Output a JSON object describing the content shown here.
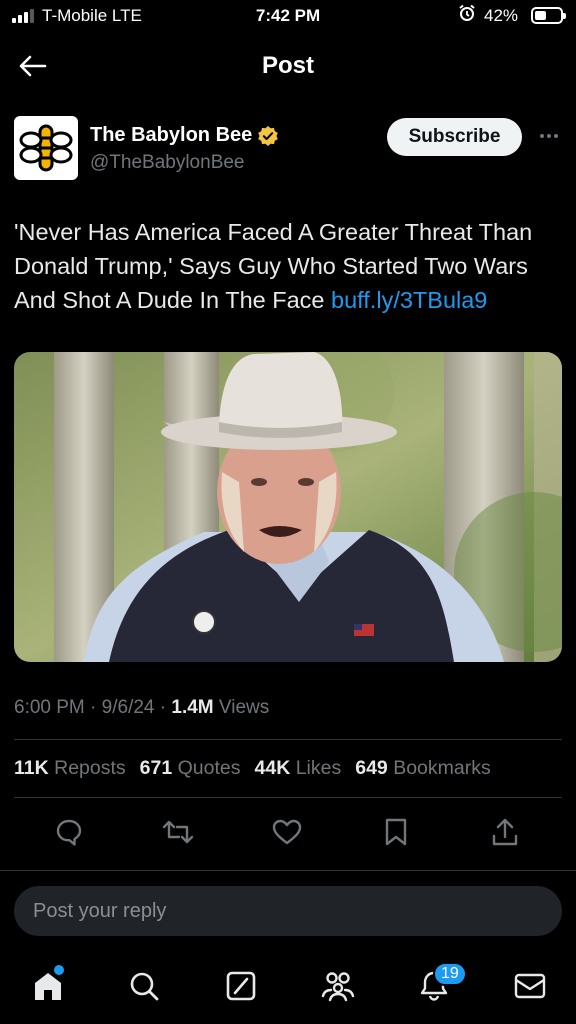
{
  "status_bar": {
    "carrier": "T-Mobile  LTE",
    "time": "7:42 PM",
    "battery": "42%",
    "battery_level": 0.42
  },
  "header": {
    "title": "Post",
    "back_icon": "arrow-left-icon"
  },
  "author": {
    "name": "The Babylon Bee",
    "handle": "@TheBabylonBee",
    "verified": true,
    "verified_color": "#f4c443",
    "subscribe_label": "Subscribe"
  },
  "post": {
    "text": "'Never Has America Faced A Greater Threat Than Donald Trump,' Says Guy Who Started Two Wars And Shot A Dude In The Face ",
    "link": "buff.ly/3TBula9",
    "media_icon": "video-still"
  },
  "meta": {
    "time": "6:00 PM",
    "sep1": " · ",
    "date": "9/6/24",
    "sep2": " · ",
    "views_count": "1.4M",
    "views_label": " Views"
  },
  "stats": [
    {
      "count": "11K",
      "label": " Reposts"
    },
    {
      "count": "671",
      "label": " Quotes"
    },
    {
      "count": "44K",
      "label": " Likes"
    },
    {
      "count": "649",
      "label": " Bookmarks"
    }
  ],
  "actions": [
    "reply-icon",
    "repost-icon",
    "like-icon",
    "bookmark-icon",
    "share-icon"
  ],
  "reply_box": {
    "placeholder": "Post your reply"
  },
  "tabbar": {
    "items": [
      "home-icon",
      "search-icon",
      "grok-icon",
      "communities-icon",
      "notifications-icon",
      "messages-icon"
    ],
    "notification_count": "19"
  },
  "colors": {
    "background": "#000000",
    "accent": "#1d9bf0",
    "text": "#e7e9ea",
    "muted": "#71767b"
  }
}
